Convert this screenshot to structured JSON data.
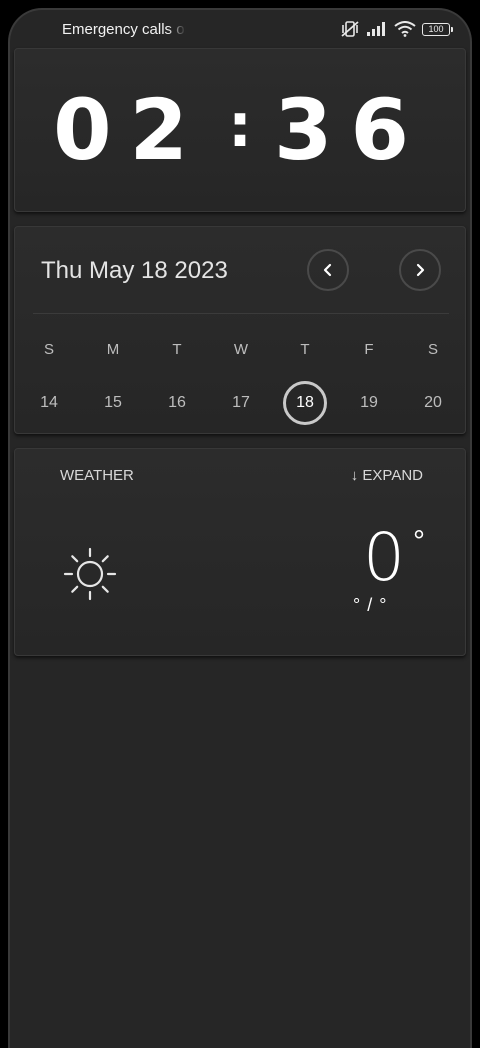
{
  "status_bar": {
    "carrier_text": "Emergency calls only",
    "battery_level": "100",
    "icons": [
      "vibrate-off-icon",
      "signal-icon",
      "wifi-icon",
      "battery-icon"
    ]
  },
  "clock": {
    "hours": "02",
    "separator": ":",
    "minutes": "36"
  },
  "calendar": {
    "date_label": "Thu May 18 2023",
    "weekdays": [
      "S",
      "M",
      "T",
      "W",
      "T",
      "F",
      "S"
    ],
    "dates": [
      "14",
      "15",
      "16",
      "17",
      "18",
      "19",
      "20"
    ],
    "selected_date": "18"
  },
  "weather": {
    "title": "WEATHER",
    "expand_label": "↓ EXPAND",
    "icon": "sun-icon",
    "temperature": "0",
    "degree_symbol": "°",
    "range": "° / °"
  },
  "colors": {
    "background": "#262626",
    "text": "#ffffff",
    "muted_text": "#bdbdbd"
  }
}
